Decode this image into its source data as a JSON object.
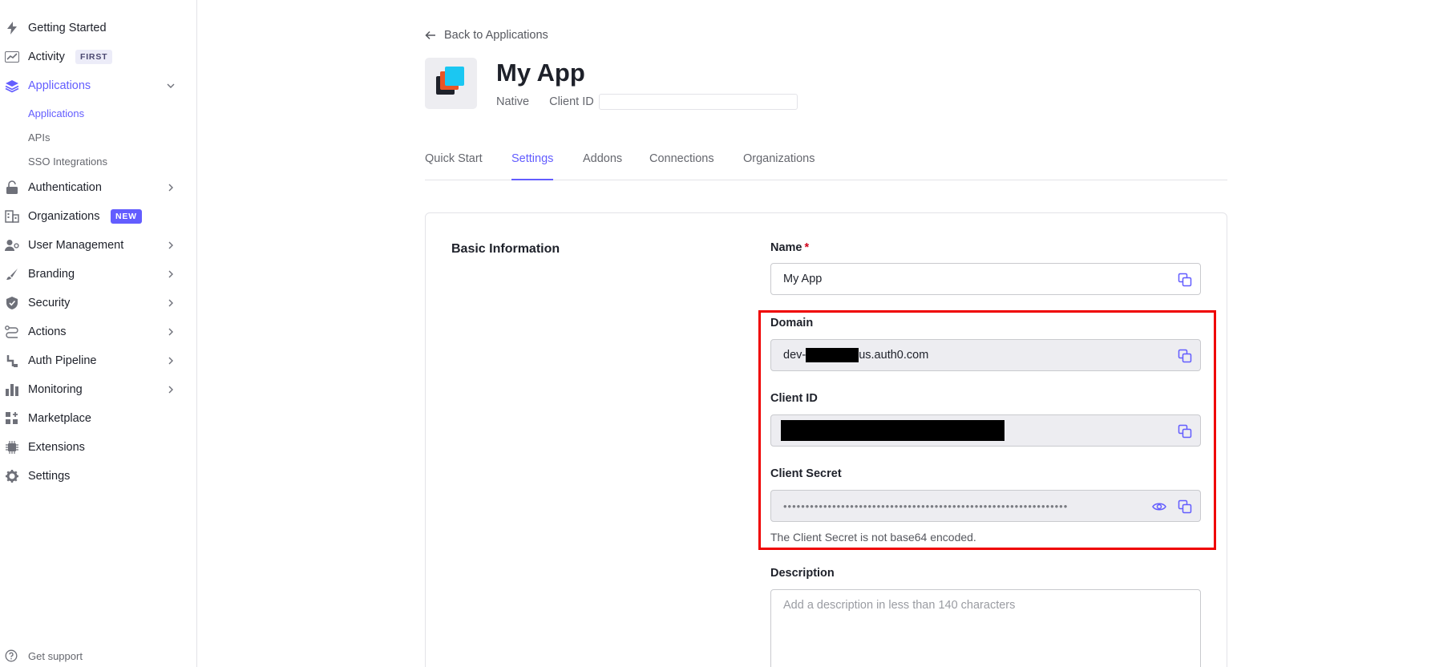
{
  "sidebar": {
    "items": [
      {
        "label": "Getting Started"
      },
      {
        "label": "Activity",
        "badge": "FIRST"
      },
      {
        "label": "Applications"
      },
      {
        "label": "Authentication"
      },
      {
        "label": "Organizations",
        "badge": "NEW"
      },
      {
        "label": "User Management"
      },
      {
        "label": "Branding"
      },
      {
        "label": "Security"
      },
      {
        "label": "Actions"
      },
      {
        "label": "Auth Pipeline"
      },
      {
        "label": "Monitoring"
      },
      {
        "label": "Marketplace"
      },
      {
        "label": "Extensions"
      },
      {
        "label": "Settings"
      }
    ],
    "subitems": [
      {
        "label": "Applications"
      },
      {
        "label": "APIs"
      },
      {
        "label": "SSO Integrations"
      }
    ],
    "support": "Get support"
  },
  "header": {
    "back_label": "Back to Applications",
    "app_name": "My App",
    "app_type": "Native",
    "client_id_label": "Client ID"
  },
  "tabs": [
    {
      "label": "Quick Start"
    },
    {
      "label": "Settings"
    },
    {
      "label": "Addons"
    },
    {
      "label": "Connections"
    },
    {
      "label": "Organizations"
    }
  ],
  "settings": {
    "section_title": "Basic Information",
    "name_label": "Name",
    "name_required": "*",
    "name_value": "My App",
    "domain_label": "Domain",
    "domain_prefix": "dev-",
    "domain_suffix": "us.auth0.com",
    "client_id_label": "Client ID",
    "client_secret_label": "Client Secret",
    "client_secret_masked": "••••••••••••••••••••••••••••••••••••••••••••••••••••••••••••••••",
    "client_secret_note": "The Client Secret is not base64 encoded.",
    "description_label": "Description",
    "description_placeholder": "Add a description in less than 140 characters"
  },
  "colors": {
    "accent": "#635dff",
    "highlight": "#ef0000"
  }
}
